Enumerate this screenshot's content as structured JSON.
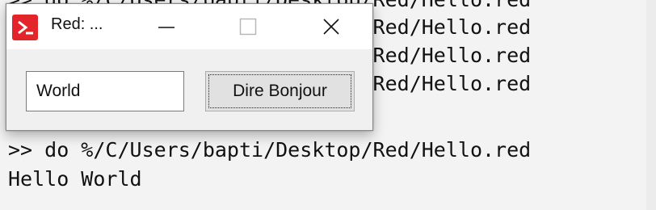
{
  "console": {
    "lines": [
      ">> do %/C/Users/bapti/Desktop/Red/Hello.red",
      ">> do %/C/Users/bapti/Desktop/Red/Hello.red",
      ">> do %/C/Users/bapti/Desktop/Red/Hello.red",
      ">> do %/C/Users/bapti/Desktop/Red/Hello.red",
      ">> do %/C/Users/bapti/Desktop/Red/Hello.red",
      "Hello World"
    ]
  },
  "window": {
    "title": "Red: ...",
    "field_value": "World",
    "button_label": "Dire Bonjour",
    "icon": "red-app-icon",
    "controls": [
      "minimize-icon",
      "maximize-icon",
      "close-icon"
    ],
    "accent_color": "#e3242b"
  }
}
